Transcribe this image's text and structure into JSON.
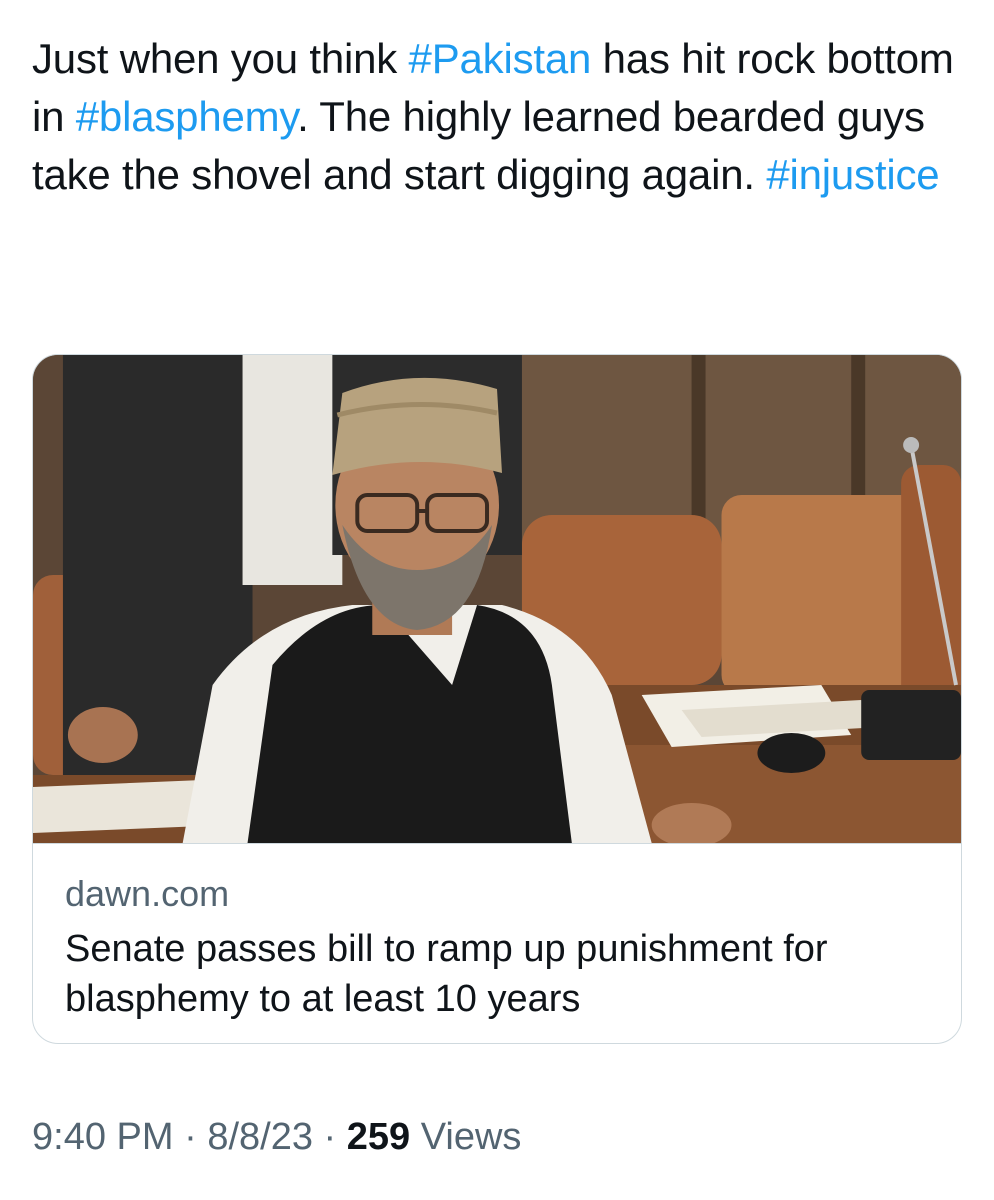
{
  "tweet": {
    "text_parts": [
      {
        "type": "text",
        "value": "Just when you think "
      },
      {
        "type": "hashtag",
        "value": "#Pakistan"
      },
      {
        "type": "text",
        "value": " has hit rock bottom in "
      },
      {
        "type": "hashtag",
        "value": "#blasphemy"
      },
      {
        "type": "text",
        "value": ". The highly learned bearded guys take the shovel and start digging again. "
      },
      {
        "type": "hashtag",
        "value": "#injustice"
      }
    ],
    "colors": {
      "hashtag": "#1d9bf0",
      "text": "#0f1419",
      "secondary": "#536471"
    }
  },
  "card": {
    "domain": "dawn.com",
    "title": "Senate passes bill to ramp up punishment for blasphemy to at least 10 years"
  },
  "meta": {
    "time": "9:40 PM",
    "separator": "·",
    "date": "8/8/23",
    "views_count": "259",
    "views_label": "Views"
  }
}
